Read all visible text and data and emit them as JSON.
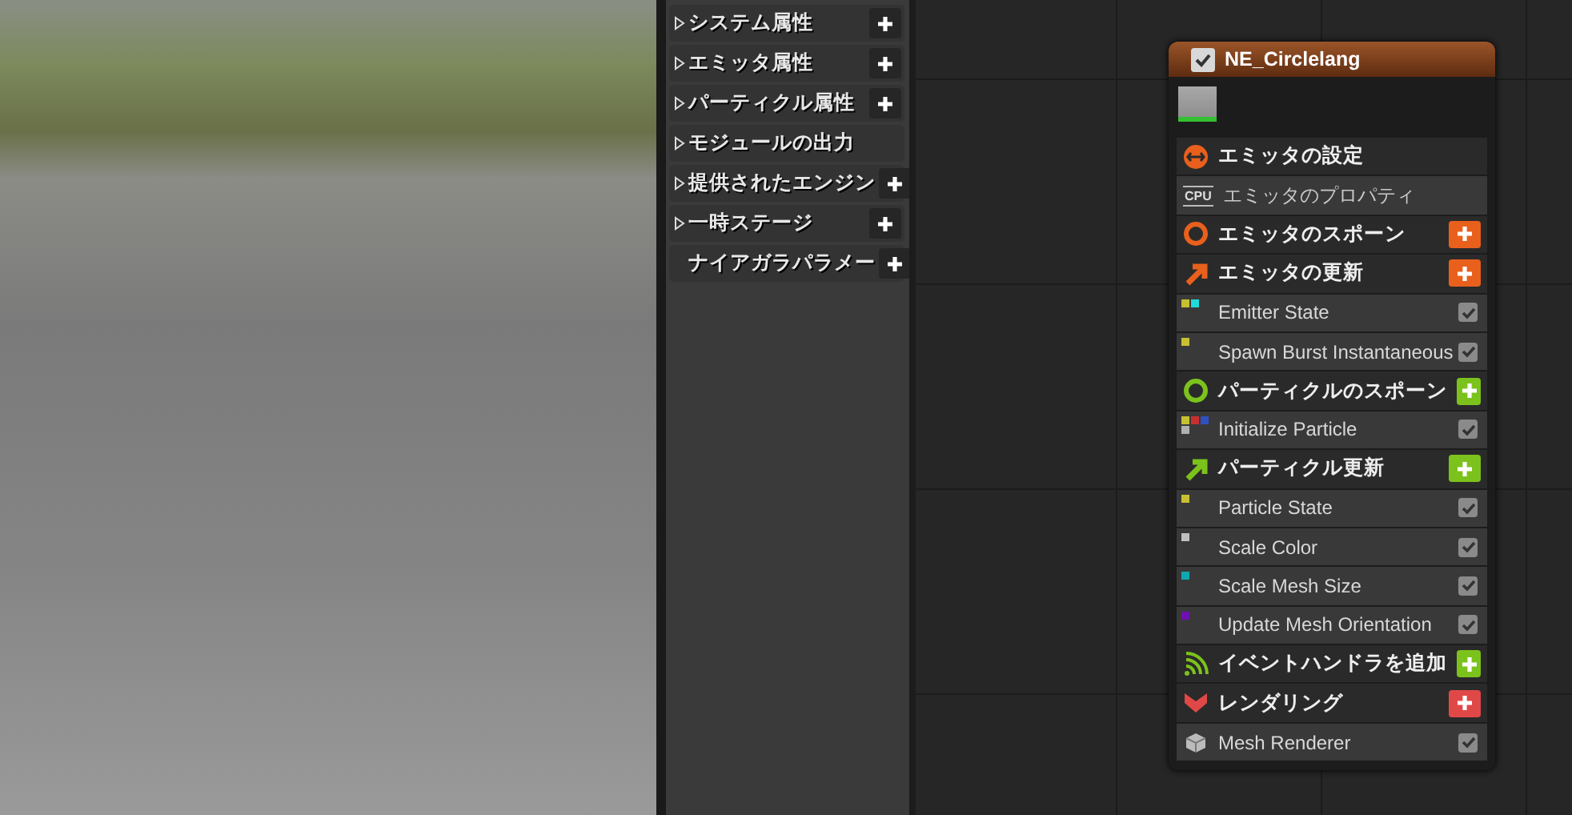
{
  "sections": [
    {
      "label": "システム属性",
      "expander": true,
      "add_button": true
    },
    {
      "label": "エミッタ属性",
      "expander": true,
      "add_button": true
    },
    {
      "label": "パーティクル属性",
      "expander": true,
      "add_button": true
    },
    {
      "label": "モジュールの出力",
      "expander": true,
      "add_button": false
    },
    {
      "label": "提供されたエンジン",
      "expander": true,
      "add_button": true
    },
    {
      "label": "一時ステージ",
      "expander": true,
      "add_button": true
    },
    {
      "label": "ナイアガラパラメー",
      "expander": false,
      "add_button": true
    }
  ],
  "node": {
    "title": "NE_Circlelang",
    "checked": true,
    "rows": [
      {
        "kind": "settings",
        "label": "エミッタの設定",
        "color": "#e8601c",
        "add_button": false
      },
      {
        "kind": "property",
        "badge": "CPU",
        "label": "エミッタのプロパティ"
      },
      {
        "kind": "spawn",
        "label": "エミッタのスポーン",
        "color": "#e8601c",
        "add_button": true
      },
      {
        "kind": "update",
        "label": "エミッタの更新",
        "color": "#e8601c",
        "add_button": true
      },
      {
        "kind": "module",
        "label": "Emitter State",
        "checked": true,
        "dots": [
          {
            "color": "#c8c030"
          },
          {
            "color": "#20d8d8"
          }
        ]
      },
      {
        "kind": "module",
        "label": "Spawn Burst Instantaneous",
        "checked": true,
        "dots": [
          {
            "color": "#c8c030"
          }
        ]
      },
      {
        "kind": "spawn",
        "label": "パーティクルのスポーン",
        "color": "#7cc21c",
        "add_button": true
      },
      {
        "kind": "module",
        "label": "Initialize Particle",
        "checked": true,
        "dots": [
          {
            "color": "#c8c030"
          },
          {
            "color": "#c83030"
          },
          {
            "color": "#3050c0"
          },
          {
            "color": "#b0b0b0"
          }
        ]
      },
      {
        "kind": "update",
        "label": "パーティクル更新",
        "color": "#7cc21c",
        "add_button": true
      },
      {
        "kind": "module",
        "label": "Particle State",
        "checked": true,
        "dots": [
          {
            "color": "#c8c030"
          }
        ]
      },
      {
        "kind": "module",
        "label": "Scale Color",
        "checked": true,
        "dots": [
          {
            "color": "#c0c0c0"
          }
        ]
      },
      {
        "kind": "module",
        "label": "Scale Mesh Size",
        "checked": true,
        "dots": [
          {
            "color": "#10a8b0"
          }
        ]
      },
      {
        "kind": "module",
        "label": "Update Mesh Orientation",
        "checked": true,
        "dots": [
          {
            "color": "#7010b0"
          }
        ]
      },
      {
        "kind": "event",
        "label": "イベントハンドラを追加",
        "color": "#7cc21c",
        "add_button": true
      },
      {
        "kind": "render",
        "label": "レンダリング",
        "color": "#e04848",
        "add_button": true
      },
      {
        "kind": "renderer",
        "label": "Mesh Renderer",
        "checked": true
      }
    ]
  }
}
